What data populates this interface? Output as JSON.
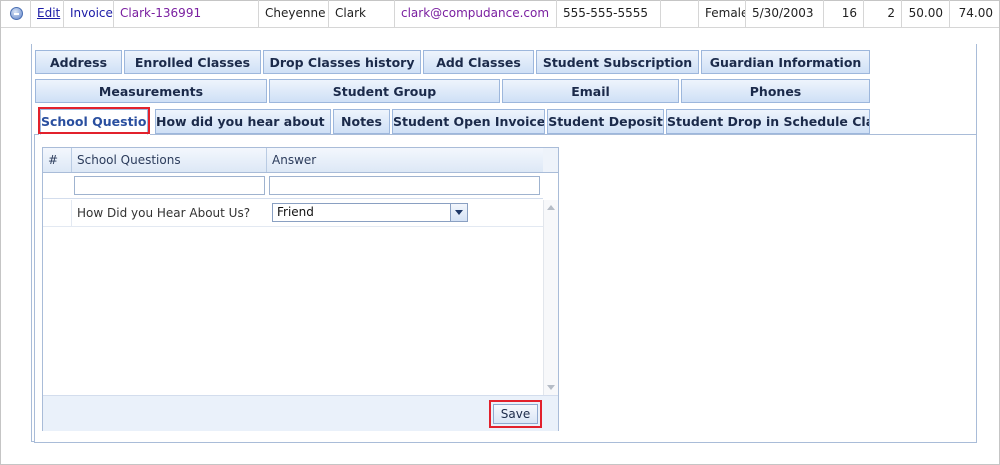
{
  "record": {
    "edit": "Edit",
    "invoice": "Invoice",
    "code": "Clark-136991",
    "first_name": "Cheyenne",
    "last_name": "Clark",
    "email": "clark@compudance.com",
    "phone": "555-555-5555",
    "blank": "",
    "gender": "Female",
    "dob": "5/30/2003",
    "age": "16",
    "num": "2",
    "amount1": "50.00",
    "amount2": "74.00"
  },
  "tabs": {
    "row1": [
      "Address",
      "Enrolled Classes",
      "Drop Classes history",
      "Add Classes",
      "Student Subscription",
      "Guardian Information"
    ],
    "row2": [
      "Measurements",
      "Student Group",
      "Email",
      "Phones"
    ],
    "row3": [
      "School Question",
      "How did you hear about Us",
      "Notes",
      "Student Open Invoices",
      "Student Deposit",
      "Student Drop in Schedule Class"
    ],
    "active": "School Question"
  },
  "grid": {
    "headers": {
      "num": "#",
      "question": "School Questions",
      "answer": "Answer"
    },
    "rows": [
      {
        "question": "How Did you Hear About Us?",
        "answer": "Friend"
      }
    ],
    "save_label": "Save"
  },
  "colors": {
    "highlight": "#e2212c",
    "tab_bg": "#cfe0f6",
    "link": "#1a1aa6"
  }
}
